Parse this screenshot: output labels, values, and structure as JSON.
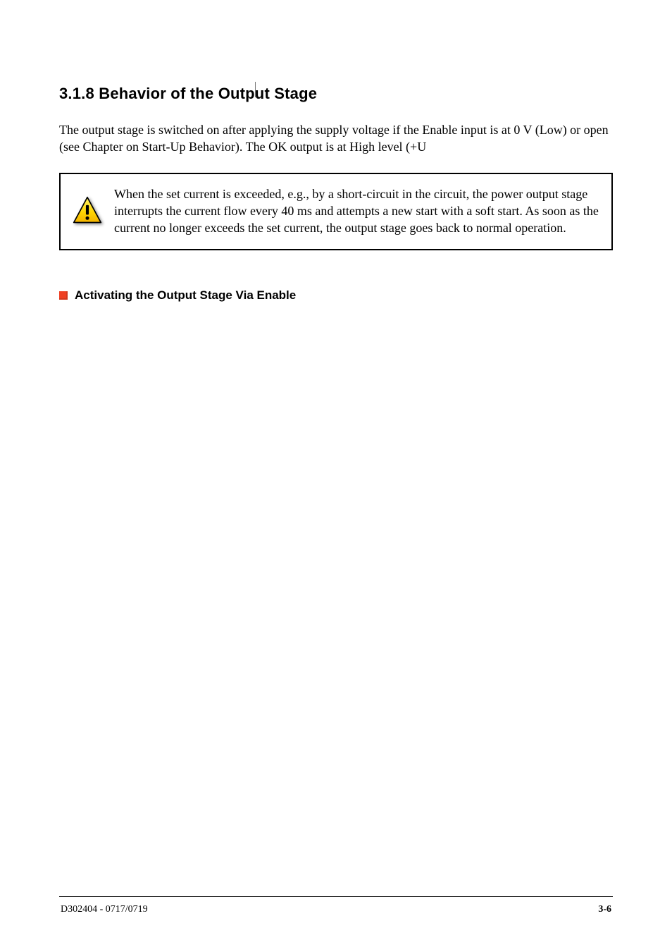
{
  "section": {
    "title": "3.1.8 Behavior of the Output Stage",
    "body": "The output stage is switched on after applying the supply voltage if the Enable input is at 0 V (Low) or open (see Chapter on Start-Up Behavior). The OK output is at High level (+U"
  },
  "warning": {
    "text": "When the set current is exceeded, e.g., by a short-circuit in the circuit, the power output stage interrupts the current flow every 40 ms and attempts a new start with a soft start. As soon as the current no longer exceeds the set current, the output stage goes back to normal operation."
  },
  "subsection": {
    "title": "Activating the Output Stage Via Enable"
  },
  "footer": {
    "left": "D302404 - 0717/0719",
    "right": "3-6"
  }
}
